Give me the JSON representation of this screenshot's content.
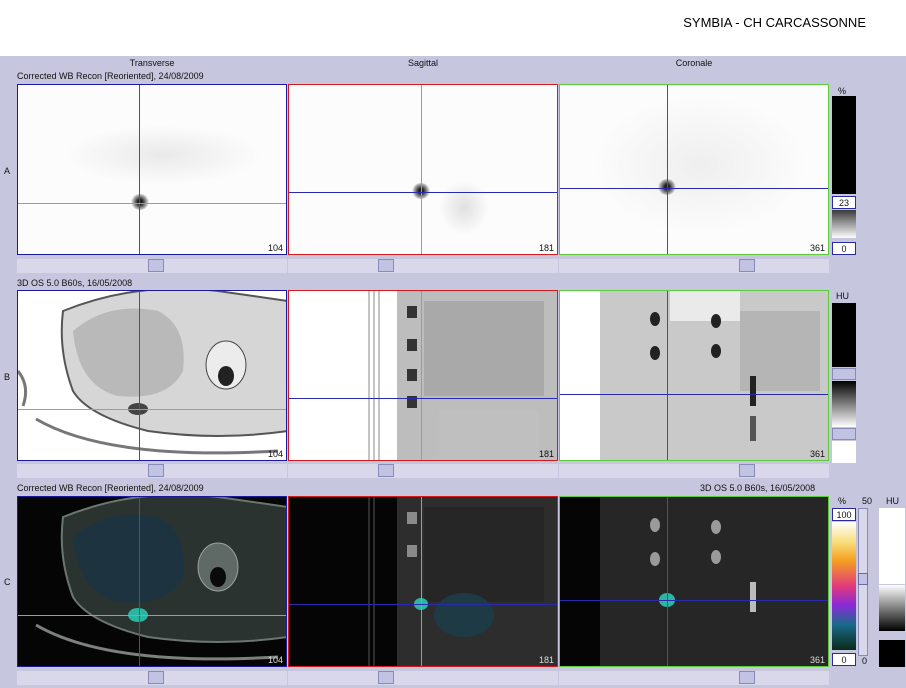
{
  "header": {
    "site": "SYMBIA - CH CARCASSONNE"
  },
  "columns": {
    "transverse": "Transverse",
    "sagittal": "Sagittal",
    "coronal": "Coronale"
  },
  "rows": {
    "a": {
      "label": "A",
      "series": "Corrected WB Recon [Reoriented], 24/08/2009",
      "slices": [
        "104",
        "181",
        "361"
      ]
    },
    "b": {
      "label": "B",
      "series": "3D  OS  5.0  B60s, 16/05/2008",
      "slices": [
        "104",
        "181",
        "361"
      ]
    },
    "c": {
      "label": "C",
      "series_left": "Corrected WB Recon [Reoriented], 24/08/2009",
      "series_right": "3D  OS  5.0  B60s, 16/05/2008",
      "slices": [
        "104",
        "181",
        "361"
      ]
    }
  },
  "scales": {
    "a": {
      "unit": "%",
      "max_value": "23",
      "min_value": "0"
    },
    "b": {
      "unit": "HU"
    },
    "c": {
      "unit_pct": "%",
      "unit_hu": "HU",
      "top_value": "100",
      "slider_top": "50",
      "min_value": "0",
      "slider_bottom": "0"
    }
  },
  "colors": {
    "crosshair_red": "#cc2222",
    "crosshair_green": "#66cc33",
    "crosshair_blue": "#2a2ab0",
    "panel_bg": "#c6c6de"
  }
}
